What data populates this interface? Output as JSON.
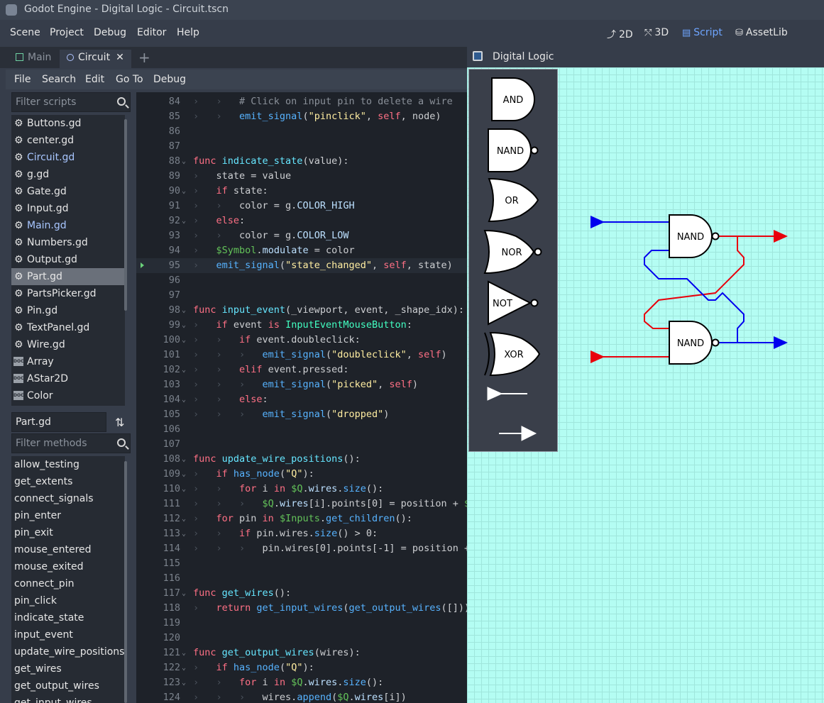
{
  "window": {
    "title": "Godot Engine - Digital Logic - Circuit.tscn"
  },
  "menubar": {
    "items": [
      "Scene",
      "Project",
      "Debug",
      "Editor",
      "Help"
    ],
    "workspaces": [
      {
        "label": "2D",
        "icon": "2d-icon"
      },
      {
        "label": "3D",
        "icon": "3d-icon"
      },
      {
        "label": "Script",
        "icon": "script-icon",
        "active": true
      },
      {
        "label": "AssetLib",
        "icon": "assetlib-icon"
      }
    ]
  },
  "tabs": [
    {
      "label": "Main"
    },
    {
      "label": "Circuit",
      "active": true,
      "close": "✕"
    }
  ],
  "script_menu": [
    "File",
    "Search",
    "Edit",
    "Go To",
    "Debug"
  ],
  "scripts": {
    "filter_placeholder": "Filter scripts",
    "items": [
      {
        "label": "Buttons.gd",
        "icon": "gear-icon"
      },
      {
        "label": "center.gd",
        "icon": "gear-icon"
      },
      {
        "label": "Circuit.gd",
        "icon": "gear-icon",
        "highlight": true
      },
      {
        "label": "g.gd",
        "icon": "gear-icon"
      },
      {
        "label": "Gate.gd",
        "icon": "gear-icon"
      },
      {
        "label": "Input.gd",
        "icon": "gear-icon"
      },
      {
        "label": "Main.gd",
        "icon": "gear-icon",
        "highlight": true
      },
      {
        "label": "Numbers.gd",
        "icon": "gear-icon"
      },
      {
        "label": "Output.gd",
        "icon": "gear-icon"
      },
      {
        "label": "Part.gd",
        "icon": "gear-icon",
        "selected": true
      },
      {
        "label": "PartsPicker.gd",
        "icon": "gear-icon"
      },
      {
        "label": "Pin.gd",
        "icon": "gear-icon"
      },
      {
        "label": "TextPanel.gd",
        "icon": "gear-icon"
      },
      {
        "label": "Wire.gd",
        "icon": "gear-icon"
      },
      {
        "label": "Array",
        "icon": "doc-icon"
      },
      {
        "label": "AStar2D",
        "icon": "doc-icon"
      },
      {
        "label": "Color",
        "icon": "doc-icon"
      }
    ],
    "current_file": "Part.gd",
    "doc_badge": "DOC"
  },
  "methods": {
    "filter_placeholder": "Filter methods",
    "items": [
      "allow_testing",
      "get_extents",
      "connect_signals",
      "pin_enter",
      "pin_exit",
      "mouse_entered",
      "mouse_exited",
      "connect_pin",
      "pin_click",
      "indicate_state",
      "input_event",
      "update_wire_positions",
      "get_wires",
      "get_output_wires",
      "get_input_wires"
    ]
  },
  "code": {
    "current_line": 95,
    "lines": [
      {
        "n": 84,
        "fold": false,
        "tokens": [
          [
            "t",
            "  "
          ],
          [
            "t",
            "  "
          ],
          [
            "cmt",
            "# Click on input pin to delete a wire"
          ]
        ]
      },
      {
        "n": 85,
        "tokens": [
          [
            "t",
            "  "
          ],
          [
            "t",
            "  "
          ],
          [
            "fn",
            "emit_signal"
          ],
          [
            "p",
            "("
          ],
          [
            "str",
            "\"pinclick\""
          ],
          [
            "p",
            ", "
          ],
          [
            "self",
            "self"
          ],
          [
            "p",
            ", node)"
          ]
        ]
      },
      {
        "n": 86,
        "tokens": []
      },
      {
        "n": 87,
        "tokens": []
      },
      {
        "n": 88,
        "fold": true,
        "tokens": [
          [
            "kw",
            "func "
          ],
          [
            "fnd",
            "indicate_state"
          ],
          [
            "p",
            "(value):"
          ]
        ]
      },
      {
        "n": 89,
        "tokens": [
          [
            "t",
            "  "
          ],
          [
            "p",
            "state = value"
          ]
        ]
      },
      {
        "n": 90,
        "fold": true,
        "tokens": [
          [
            "t",
            "  "
          ],
          [
            "kw",
            "if "
          ],
          [
            "p",
            "state:"
          ]
        ]
      },
      {
        "n": 91,
        "tokens": [
          [
            "t",
            "  "
          ],
          [
            "t",
            "  "
          ],
          [
            "p",
            "color = g."
          ],
          [
            "mem",
            "COLOR_HIGH"
          ]
        ]
      },
      {
        "n": 92,
        "fold": true,
        "tokens": [
          [
            "t",
            "  "
          ],
          [
            "kw",
            "else"
          ],
          [
            "p",
            ":"
          ]
        ]
      },
      {
        "n": 93,
        "tokens": [
          [
            "t",
            "  "
          ],
          [
            "t",
            "  "
          ],
          [
            "p",
            "color = g."
          ],
          [
            "mem",
            "COLOR_LOW"
          ]
        ]
      },
      {
        "n": 94,
        "tokens": [
          [
            "t",
            "  "
          ],
          [
            "node",
            "$Symbol"
          ],
          [
            "p",
            "."
          ],
          [
            "mem",
            "modulate"
          ],
          [
            "p",
            " = color"
          ]
        ]
      },
      {
        "n": 95,
        "tokens": [
          [
            "t",
            "  "
          ],
          [
            "fn",
            "emit_signal"
          ],
          [
            "p",
            "("
          ],
          [
            "str",
            "\"state_changed\""
          ],
          [
            "p",
            ", "
          ],
          [
            "self",
            "self"
          ],
          [
            "p",
            ", state)"
          ]
        ]
      },
      {
        "n": 96,
        "tokens": []
      },
      {
        "n": 97,
        "tokens": []
      },
      {
        "n": 98,
        "fold": true,
        "tokens": [
          [
            "kw",
            "func "
          ],
          [
            "fnd",
            "input_event"
          ],
          [
            "p",
            "(_viewport, event, _shape_idx):"
          ]
        ]
      },
      {
        "n": 99,
        "fold": true,
        "tokens": [
          [
            "t",
            "  "
          ],
          [
            "kw",
            "if "
          ],
          [
            "p",
            "event "
          ],
          [
            "kw",
            "is "
          ],
          [
            "cls",
            "InputEventMouseButton"
          ],
          [
            "p",
            ":"
          ]
        ]
      },
      {
        "n": 100,
        "fold": true,
        "tokens": [
          [
            "t",
            "  "
          ],
          [
            "t",
            "  "
          ],
          [
            "kw",
            "if "
          ],
          [
            "p",
            "event.doubleclick:"
          ]
        ]
      },
      {
        "n": 101,
        "tokens": [
          [
            "t",
            "  "
          ],
          [
            "t",
            "  "
          ],
          [
            "t",
            "  "
          ],
          [
            "fn",
            "emit_signal"
          ],
          [
            "p",
            "("
          ],
          [
            "str",
            "\"doubleclick\""
          ],
          [
            "p",
            ", "
          ],
          [
            "self",
            "self"
          ],
          [
            "p",
            ")"
          ]
        ]
      },
      {
        "n": 102,
        "fold": true,
        "tokens": [
          [
            "t",
            "  "
          ],
          [
            "t",
            "  "
          ],
          [
            "kw",
            "elif "
          ],
          [
            "p",
            "event.pressed:"
          ]
        ]
      },
      {
        "n": 103,
        "tokens": [
          [
            "t",
            "  "
          ],
          [
            "t",
            "  "
          ],
          [
            "t",
            "  "
          ],
          [
            "fn",
            "emit_signal"
          ],
          [
            "p",
            "("
          ],
          [
            "str",
            "\"picked\""
          ],
          [
            "p",
            ", "
          ],
          [
            "self",
            "self"
          ],
          [
            "p",
            ")"
          ]
        ]
      },
      {
        "n": 104,
        "fold": true,
        "tokens": [
          [
            "t",
            "  "
          ],
          [
            "t",
            "  "
          ],
          [
            "kw",
            "else"
          ],
          [
            "p",
            ":"
          ]
        ]
      },
      {
        "n": 105,
        "tokens": [
          [
            "t",
            "  "
          ],
          [
            "t",
            "  "
          ],
          [
            "t",
            "  "
          ],
          [
            "fn",
            "emit_signal"
          ],
          [
            "p",
            "("
          ],
          [
            "str",
            "\"dropped\""
          ],
          [
            "p",
            ")"
          ]
        ]
      },
      {
        "n": 106,
        "tokens": []
      },
      {
        "n": 107,
        "tokens": []
      },
      {
        "n": 108,
        "fold": true,
        "tokens": [
          [
            "kw",
            "func "
          ],
          [
            "fnd",
            "update_wire_positions"
          ],
          [
            "p",
            "():"
          ]
        ]
      },
      {
        "n": 109,
        "fold": true,
        "tokens": [
          [
            "t",
            "  "
          ],
          [
            "kw",
            "if "
          ],
          [
            "fn",
            "has_node"
          ],
          [
            "p",
            "("
          ],
          [
            "str",
            "\"Q\""
          ],
          [
            "p",
            "):"
          ]
        ]
      },
      {
        "n": 110,
        "fold": true,
        "tokens": [
          [
            "t",
            "  "
          ],
          [
            "t",
            "  "
          ],
          [
            "kw",
            "for "
          ],
          [
            "p",
            "i "
          ],
          [
            "kw",
            "in "
          ],
          [
            "node",
            "$Q"
          ],
          [
            "p",
            "."
          ],
          [
            "mem",
            "wires"
          ],
          [
            "p",
            "."
          ],
          [
            "fn",
            "size"
          ],
          [
            "p",
            "():"
          ]
        ]
      },
      {
        "n": 111,
        "tokens": [
          [
            "t",
            "  "
          ],
          [
            "t",
            "  "
          ],
          [
            "t",
            "  "
          ],
          [
            "node",
            "$Q"
          ],
          [
            "p",
            "."
          ],
          [
            "mem",
            "wires"
          ],
          [
            "p",
            "[i].points[0] = position + "
          ],
          [
            "node",
            "$"
          ]
        ]
      },
      {
        "n": 112,
        "fold": true,
        "tokens": [
          [
            "t",
            "  "
          ],
          [
            "kw",
            "for "
          ],
          [
            "p",
            "pin "
          ],
          [
            "kw",
            "in "
          ],
          [
            "node",
            "$Inputs"
          ],
          [
            "p",
            "."
          ],
          [
            "fn",
            "get_children"
          ],
          [
            "p",
            "():"
          ]
        ]
      },
      {
        "n": 113,
        "fold": true,
        "tokens": [
          [
            "t",
            "  "
          ],
          [
            "t",
            "  "
          ],
          [
            "kw",
            "if "
          ],
          [
            "p",
            "pin.wires."
          ],
          [
            "fn",
            "size"
          ],
          [
            "p",
            "() > 0:"
          ]
        ]
      },
      {
        "n": 114,
        "tokens": [
          [
            "t",
            "  "
          ],
          [
            "t",
            "  "
          ],
          [
            "t",
            "  "
          ],
          [
            "p",
            "pin.wires[0].points[-1] = position +"
          ]
        ]
      },
      {
        "n": 115,
        "tokens": []
      },
      {
        "n": 116,
        "tokens": []
      },
      {
        "n": 117,
        "fold": true,
        "tokens": [
          [
            "kw",
            "func "
          ],
          [
            "fnd",
            "get_wires"
          ],
          [
            "p",
            "():"
          ]
        ]
      },
      {
        "n": 118,
        "tokens": [
          [
            "t",
            "  "
          ],
          [
            "kw",
            "return "
          ],
          [
            "fn",
            "get_input_wires"
          ],
          [
            "p",
            "("
          ],
          [
            "fn",
            "get_output_wires"
          ],
          [
            "p",
            "([]))"
          ]
        ]
      },
      {
        "n": 119,
        "tokens": []
      },
      {
        "n": 120,
        "tokens": []
      },
      {
        "n": 121,
        "fold": true,
        "tokens": [
          [
            "kw",
            "func "
          ],
          [
            "fnd",
            "get_output_wires"
          ],
          [
            "p",
            "(wires):"
          ]
        ]
      },
      {
        "n": 122,
        "fold": true,
        "tokens": [
          [
            "t",
            "  "
          ],
          [
            "kw",
            "if "
          ],
          [
            "fn",
            "has_node"
          ],
          [
            "p",
            "("
          ],
          [
            "str",
            "\"Q\""
          ],
          [
            "p",
            "):"
          ]
        ]
      },
      {
        "n": 123,
        "fold": true,
        "tokens": [
          [
            "t",
            "  "
          ],
          [
            "t",
            "  "
          ],
          [
            "kw",
            "for "
          ],
          [
            "p",
            "i "
          ],
          [
            "kw",
            "in "
          ],
          [
            "node",
            "$Q"
          ],
          [
            "p",
            "."
          ],
          [
            "mem",
            "wires"
          ],
          [
            "p",
            "."
          ],
          [
            "fn",
            "size"
          ],
          [
            "p",
            "():"
          ]
        ]
      },
      {
        "n": 124,
        "tokens": [
          [
            "t",
            "  "
          ],
          [
            "t",
            "  "
          ],
          [
            "t",
            "  "
          ],
          [
            "p",
            "wires."
          ],
          [
            "fn",
            "append"
          ],
          [
            "p",
            "("
          ],
          [
            "node",
            "$Q"
          ],
          [
            "p",
            "."
          ],
          [
            "mem",
            "wires"
          ],
          [
            "p",
            "[i])"
          ]
        ]
      }
    ]
  },
  "game": {
    "title": "Digital Logic",
    "palette": [
      "AND",
      "NAND",
      "OR",
      "NOR",
      "NOT",
      "XOR"
    ],
    "circuit": {
      "gate_top": "NAND",
      "gate_bottom": "NAND"
    },
    "colors": {
      "high": "#e8000c",
      "low": "#0000ee",
      "grid_bg": "#b4fdf3",
      "grid_line": "#9fe6dc"
    }
  }
}
